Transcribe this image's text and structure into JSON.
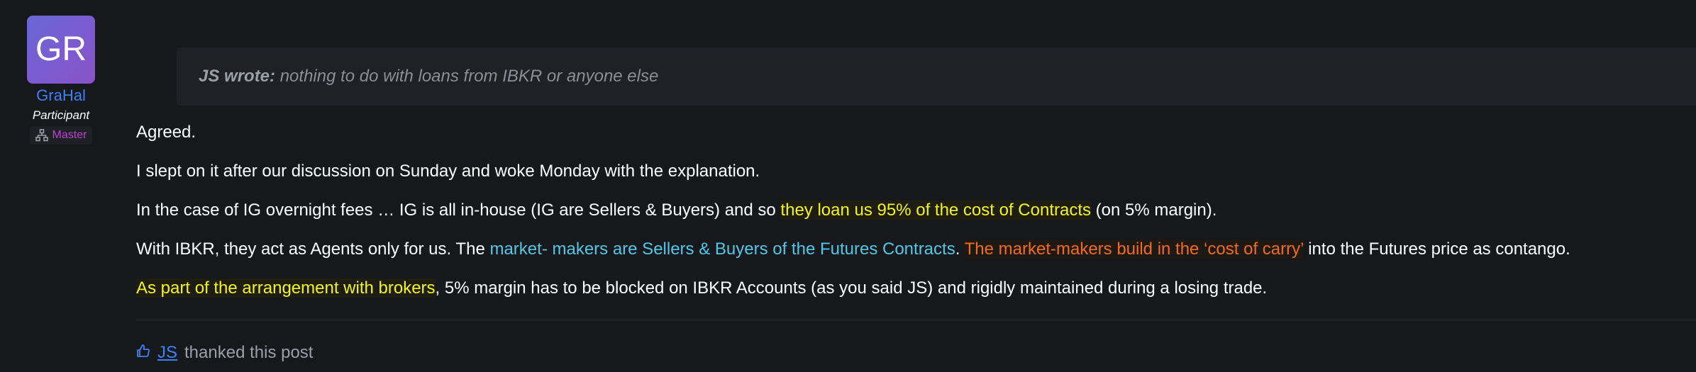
{
  "author": {
    "initials": "GR",
    "name": "GraHal",
    "role": "Participant",
    "rank": "Master"
  },
  "quote": {
    "by": "JS wrote:",
    "text": " nothing to do with loans from IBKR or anyone else"
  },
  "post": {
    "p1": "Agreed.",
    "p2": "I slept on it after our discussion on Sunday and woke Monday with the explanation.",
    "p3a": "In the case of IG overnight fees … IG is all in-house (IG are Sellers & Buyers) and so ",
    "p3b": "they loan us 95% of the cost of Contracts",
    "p3c": " (on 5% margin).",
    "p4a": "With IBKR, they act as Agents only for us. The ",
    "p4b": "market- makers are Sellers & Buyers of the Futures Contracts",
    "p4c": ". ",
    "p4d": "The market-makers build in the ‘cost of carry’",
    "p4e": " into the Futures price as contango.",
    "p5a": "As part of the arrangement with brokers",
    "p5b": ", 5% margin has to be blocked on IBKR Accounts (as you said JS) and rigidly maintained during a losing trade."
  },
  "thanks": {
    "user": "JS",
    "text": "thanked this post"
  },
  "colors": {
    "background": "#17181c",
    "highlight_yellow": "#f4f41a",
    "highlight_cyan": "#4fc8e8",
    "highlight_orange": "#f26b16",
    "link": "#3b82f6",
    "rank": "#c23fd6"
  },
  "icons": {
    "rank": "hierarchy-icon",
    "thanks": "thumbs-up-icon"
  }
}
